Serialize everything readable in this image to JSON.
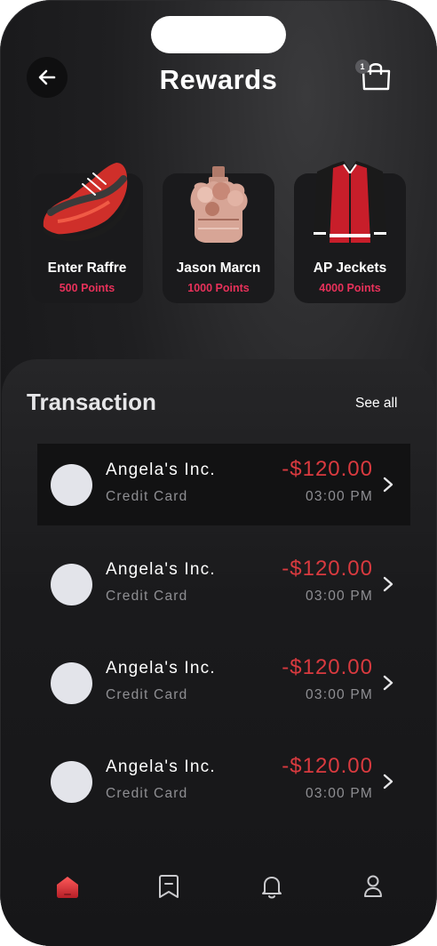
{
  "header": {
    "title": "Rewards",
    "back_icon": "arrow-left-icon",
    "bag_icon": "shopping-bag-icon",
    "bag_badge": "1"
  },
  "rewards": [
    {
      "name": "Enter Raffre",
      "points": "500 Points",
      "image": "red-sneaker-image"
    },
    {
      "name": "Jason Marcn",
      "points": "1000 Points",
      "image": "perfume-bottle-image"
    },
    {
      "name": "AP Jeckets",
      "points": "4000 Points",
      "image": "red-varsity-jacket-image"
    }
  ],
  "transactions_section": {
    "title": "Transaction",
    "see_all": "See all",
    "items": [
      {
        "name": "Angela's Inc.",
        "method": "Credit Card",
        "amount": "-$120.00",
        "time": "03:00 PM"
      },
      {
        "name": "Angela's Inc.",
        "method": "Credit Card",
        "amount": "-$120.00",
        "time": "03:00 PM"
      },
      {
        "name": "Angela's Inc.",
        "method": "Credit Card",
        "amount": "-$120.00",
        "time": "03:00 PM"
      },
      {
        "name": "Angela's Inc.",
        "method": "Credit Card",
        "amount": "-$120.00",
        "time": "03:00 PM"
      }
    ]
  },
  "nav": {
    "items": [
      {
        "icon": "home-icon",
        "active": true
      },
      {
        "icon": "bookmark-icon",
        "active": false
      },
      {
        "icon": "bell-icon",
        "active": false
      },
      {
        "icon": "profile-icon",
        "active": false
      }
    ]
  },
  "colors": {
    "accent": "#e8315a",
    "amount": "#d93a3f",
    "background": "#1c1c1e"
  }
}
